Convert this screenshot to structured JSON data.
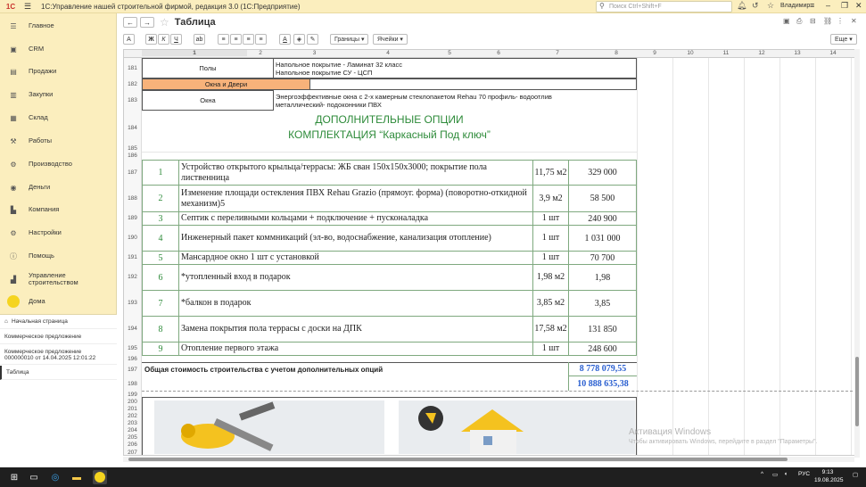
{
  "titlebar": {
    "logo": "1С",
    "app_title": "1С:Управление нашей строительной фирмой, редакция 3.0  (1С:Предприятие)",
    "search_placeholder": "Поиск Ctrl+Shift+F",
    "user": "Владимир"
  },
  "sidebar": {
    "items": [
      {
        "label": "Главное",
        "icon": "menu-icon"
      },
      {
        "label": "CRM",
        "icon": "crm-icon"
      },
      {
        "label": "Продажи",
        "icon": "sales-icon"
      },
      {
        "label": "Закупки",
        "icon": "purchases-icon"
      },
      {
        "label": "Склад",
        "icon": "warehouse-icon"
      },
      {
        "label": "Работы",
        "icon": "works-icon"
      },
      {
        "label": "Производство",
        "icon": "production-icon"
      },
      {
        "label": "Деньги",
        "icon": "money-icon"
      },
      {
        "label": "Компания",
        "icon": "company-icon"
      },
      {
        "label": "Настройки",
        "icon": "settings-icon"
      },
      {
        "label": "Помощь",
        "icon": "help-icon"
      },
      {
        "label": "Управление строительством",
        "icon": "construction-icon"
      },
      {
        "label": "Дома",
        "icon": "houses-icon"
      }
    ],
    "open_windows": [
      {
        "label": "Начальная страница"
      },
      {
        "label": "Коммерческое предложение"
      },
      {
        "label": "Коммерческое предложение 000000010 от 14.04.2025 12:01:22"
      },
      {
        "label": "Таблица"
      }
    ]
  },
  "document": {
    "title": "Таблица",
    "toolbar": {
      "font_btn": "A",
      "bold": "Ж",
      "italic": "К",
      "underline": "Ч",
      "borders": "Границы",
      "cells": "Ячейки",
      "more": "Еще"
    }
  },
  "sheet": {
    "columns": [
      "1",
      "2",
      "3",
      "4",
      "5",
      "6",
      "7",
      "8",
      "9",
      "10",
      "11",
      "12",
      "13",
      "14"
    ],
    "row_numbers": [
      "181",
      "182",
      "183",
      "184",
      "185",
      "186",
      "187",
      "188",
      "189",
      "190",
      "191",
      "192",
      "193",
      "194",
      "195",
      "196",
      "197",
      "198",
      "199",
      "200",
      "201",
      "202",
      "203",
      "204",
      "205",
      "206",
      "207"
    ],
    "floors": {
      "label": "Полы",
      "line1": "Напольное покрытие - Ламинат 32 класс",
      "line2": "Напольное покрытие СУ - ЦСП"
    },
    "windows_header": "Окна и Двери",
    "windows": {
      "label": "Окна",
      "line1": "Энергоэффективные окна с 2-х камерным стеклопакетом Rehau 70 профиль- водоотлив",
      "line2": "металлический- подоконники ПВХ"
    },
    "options_title_1": "ДОПОЛНИТЕЛЬНЫЕ ОПЦИИ",
    "options_title_2": "КОМПЛЕКТАЦИЯ “Каркасный Под ключ”",
    "options": [
      {
        "num": "1",
        "text": "Устройство открытого крыльца/террасы: ЖБ сван 150х150х3000; покрытие пола лиственница",
        "qty": "11,75 м2",
        "price": "329 000"
      },
      {
        "num": "2",
        "text": "Изменение площади остекления ПВХ Rehau Grazio (прямоуг. форма) (поворотно-откидной механизм)5",
        "qty": "3,9 м2",
        "price": "58 500"
      },
      {
        "num": "3",
        "text": "Септик с переливными кольцами + подключение + пусконаладка",
        "qty": "1  шт",
        "price": "240 900"
      },
      {
        "num": "4",
        "text": "Инженерный пакет коммникаций (эл-во, водоснабжение, канализация отопление)",
        "qty": "1  шт",
        "price": "1 031 000"
      },
      {
        "num": "5",
        "text": "Мансардное окно 1 шт с установкой",
        "qty": "1  шт",
        "price": "70 700"
      },
      {
        "num": "6",
        "text": "*утопленный вход в подарок",
        "qty": "1,98 м2",
        "price": "1,98"
      },
      {
        "num": "7",
        "text": "*балкон в подарок",
        "qty": "3,85 м2",
        "price": "3,85"
      },
      {
        "num": "8",
        "text": "Замена покрытия пола террасы с доски на ДПК",
        "qty": "17,58 м2",
        "price": "131 850"
      },
      {
        "num": "9",
        "text": "Отопление первого этажа",
        "qty": "1  шт",
        "price": "248 600"
      }
    ],
    "total_label": "Общая стоимость строительства с учетом дополнительных опций",
    "total_1": "8 778 079,55",
    "total_2": "10 888 635,38"
  },
  "activation": {
    "line1": "Активация Windows",
    "line2": "Чтобы активировать Windows, перейдите в раздел \"Параметры\"."
  },
  "taskbar": {
    "lang": "РУС",
    "time": "9:13",
    "date": "19.08.2025"
  },
  "colors": {
    "accent_yellow": "#fbeebe",
    "orange_header": "#f7b27a",
    "green_text": "#2e8b3a",
    "blue_total": "#2a5fd0"
  }
}
